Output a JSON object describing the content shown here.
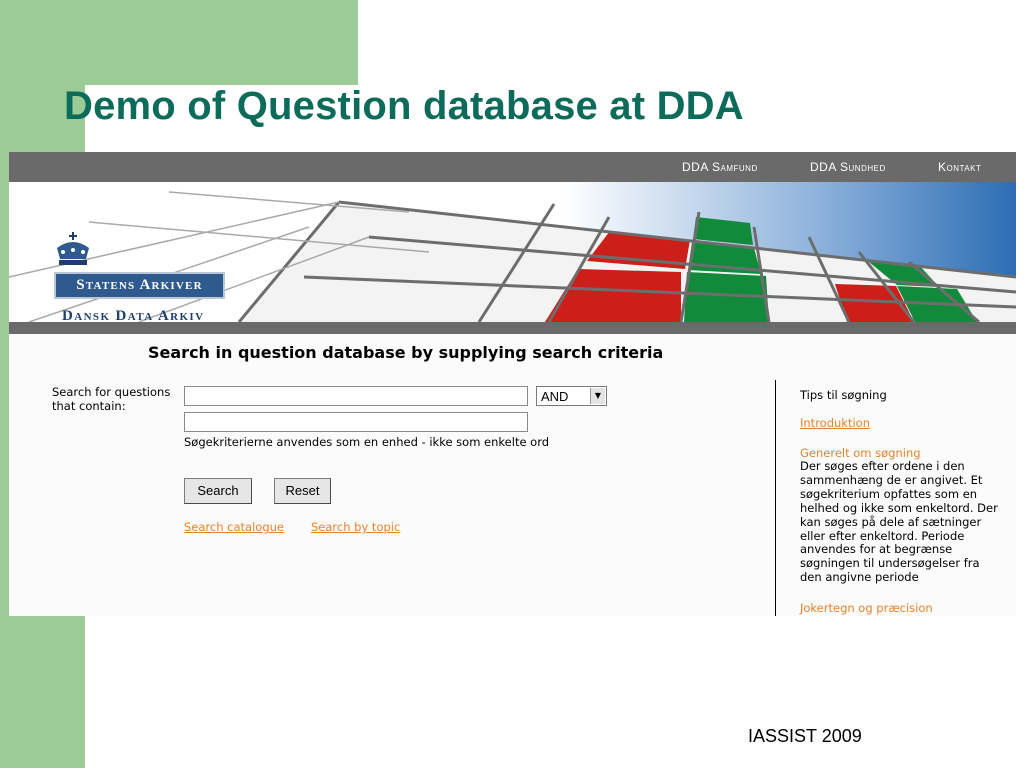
{
  "slide": {
    "title": "Demo of Question database at DDA",
    "footer": "IASSIST 2009"
  },
  "nav": {
    "items": [
      "DDA Samfund",
      "DDA Sundhed",
      "Kontakt"
    ]
  },
  "logo": {
    "box_text": "Statens Arkiver",
    "sub_text": "Dansk Data Arkiv"
  },
  "search": {
    "heading": "Search in  question database by supplying search criteria",
    "label": "Search for questions that contain:",
    "input1_value": "",
    "input2_value": "",
    "operator": "AND",
    "hint": "Søgekriterierne anvendes som en enhed - ikke som enkelte ord",
    "search_button": "Search",
    "reset_button": "Reset",
    "links": [
      "Search catalogue",
      "Search by topic"
    ]
  },
  "tips": {
    "title": "Tips til søgning",
    "intro_link": "Introduktion",
    "general_link": "Generelt om søgning",
    "general_text": "Der søges efter ordene i den sammenhæng de er angivet. Et søgekriterium opfattes som en helhed og ikke som enkeltord. Der kan søges på dele af sætninger eller efter enkeltord. Periode anvendes for at begrænse søgningen til undersøgelser fra den angivne periode",
    "wildcard_link": "Jokertegn og præcision"
  },
  "colors": {
    "slide_green": "#9dcb97",
    "title_teal": "#0d6b5a",
    "bar_gray": "#6a6a6a",
    "logo_blue": "#2f5a8e",
    "link_orange": "#e8822a",
    "tile_red": "#cc1f1a",
    "tile_green": "#128a3b"
  }
}
